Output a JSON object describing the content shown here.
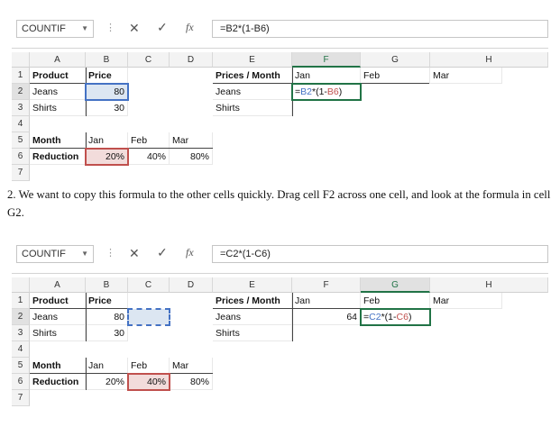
{
  "shot1": {
    "name_box": "COUNTIF",
    "formula": "=B2*(1-B6)",
    "columns": [
      "A",
      "B",
      "C",
      "D",
      "E",
      "F",
      "G",
      "H"
    ],
    "rows": [
      "1",
      "2",
      "3",
      "4",
      "5",
      "6",
      "7"
    ],
    "cells": {
      "A1": "Product",
      "B1": "Price",
      "E1": "Prices / Month",
      "F1": "Jan",
      "G1": "Feb",
      "H1": "Mar",
      "A2": "Jeans",
      "B2": "80",
      "E2": "Jeans",
      "F2_parts": [
        "=",
        "B2",
        "*(1-",
        "B6",
        ")"
      ],
      "A3": "Shirts",
      "B3": "30",
      "E3": "Shirts",
      "A5": "Month",
      "B5": "Jan",
      "C5": "Feb",
      "D5": "Mar",
      "A6": "Reduction",
      "B6": "20%",
      "C6": "40%",
      "D6": "80%"
    }
  },
  "instruction": "2. We want to copy this formula to the other cells quickly. Drag cell F2 across one cell, and look at the formula in cell G2.",
  "shot2": {
    "name_box": "COUNTIF",
    "formula": "=C2*(1-C6)",
    "columns": [
      "A",
      "B",
      "C",
      "D",
      "E",
      "F",
      "G",
      "H"
    ],
    "rows": [
      "1",
      "2",
      "3",
      "4",
      "5",
      "6",
      "7"
    ],
    "cells": {
      "A1": "Product",
      "B1": "Price",
      "E1": "Prices / Month",
      "F1": "Jan",
      "G1": "Feb",
      "H1": "Mar",
      "A2": "Jeans",
      "B2": "80",
      "E2": "Jeans",
      "F2": "64",
      "G2_parts": [
        "=",
        "C2",
        "*(1-",
        "C6",
        ")"
      ],
      "A3": "Shirts",
      "B3": "30",
      "E3": "Shirts",
      "A5": "Month",
      "B5": "Jan",
      "C5": "Feb",
      "D5": "Mar",
      "A6": "Reduction",
      "B6": "20%",
      "C6": "40%",
      "D6": "80%"
    }
  },
  "icons": [
    "cancel-icon",
    "enter-check-icon",
    "insert-function-icon",
    "dropdown-arrow-icon"
  ]
}
